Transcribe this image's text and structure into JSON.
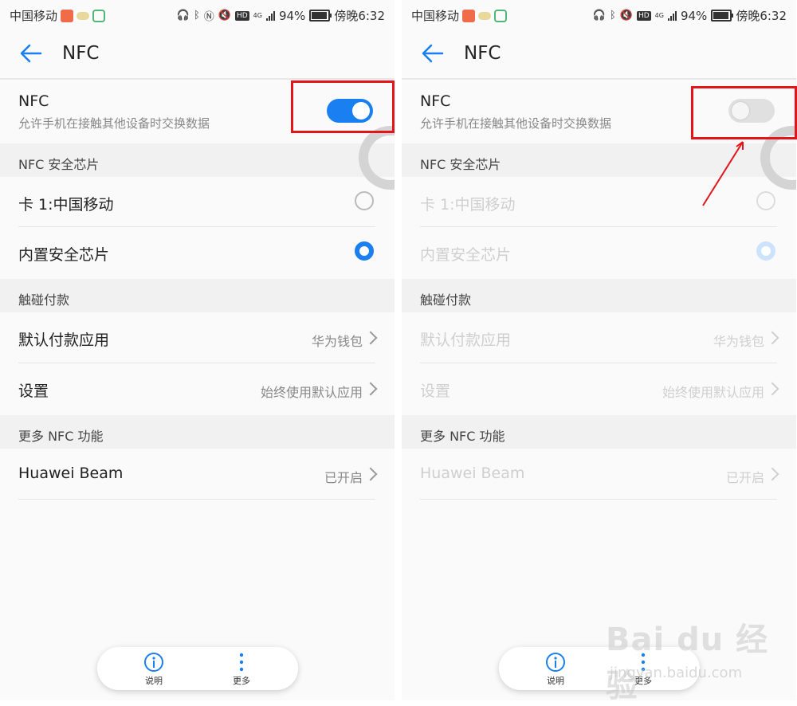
{
  "status_bar": {
    "carrier": "中国移动",
    "network": "4G",
    "battery": "94%",
    "time": "傍晚6:32"
  },
  "header": {
    "title": "NFC"
  },
  "nfc": {
    "title": "NFC",
    "desc": "允许手机在接触其他设备时交换数据"
  },
  "sections": {
    "secure_chip": "NFC 安全芯片",
    "payment": "触碰付款",
    "more_nfc": "更多 NFC 功能"
  },
  "items": {
    "card1": "卡 1:中国移动",
    "builtin_chip": "内置安全芯片",
    "default_pay": "默认付款应用",
    "default_pay_value": "华为钱包",
    "settings": "设置",
    "settings_value": "始终使用默认应用",
    "beam": "Huawei Beam",
    "beam_value": "已开启"
  },
  "bottom": {
    "info": "说明",
    "more": "更多"
  },
  "left_state": {
    "nfc_on": true
  },
  "right_state": {
    "nfc_on": false
  },
  "watermark": {
    "brand": "Bai du 经验",
    "url": "jingyan.baidu.com"
  },
  "colors": {
    "accent": "#1a7ff0",
    "annotation": "#e4141b"
  }
}
